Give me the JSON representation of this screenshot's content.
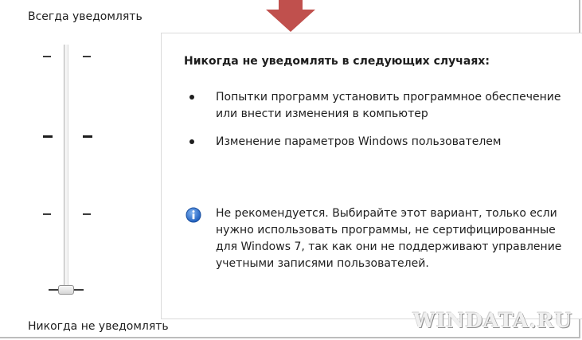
{
  "slider": {
    "top_label": "Всегда уведомлять",
    "bottom_label": "Никогда не уведомлять",
    "selected_level": 0,
    "level_count": 4
  },
  "panel": {
    "heading": "Никогда не уведомлять в следующих случаях:",
    "bullets": [
      "Попытки программ установить программное обеспечение или внести изменения в компьютер",
      "Изменение параметров Windows пользователем"
    ],
    "note_icon": "info-icon",
    "note": "Не рекомендуется. Выбирайте этот вариант, только если нужно использовать программы, не сертифицированные для Windows 7, так как они не поддерживают управление учетными записями пользователей."
  },
  "pointer": {
    "icon": "down-arrow-icon",
    "color": "#c0504d"
  },
  "watermark": "WINDATA.RU"
}
